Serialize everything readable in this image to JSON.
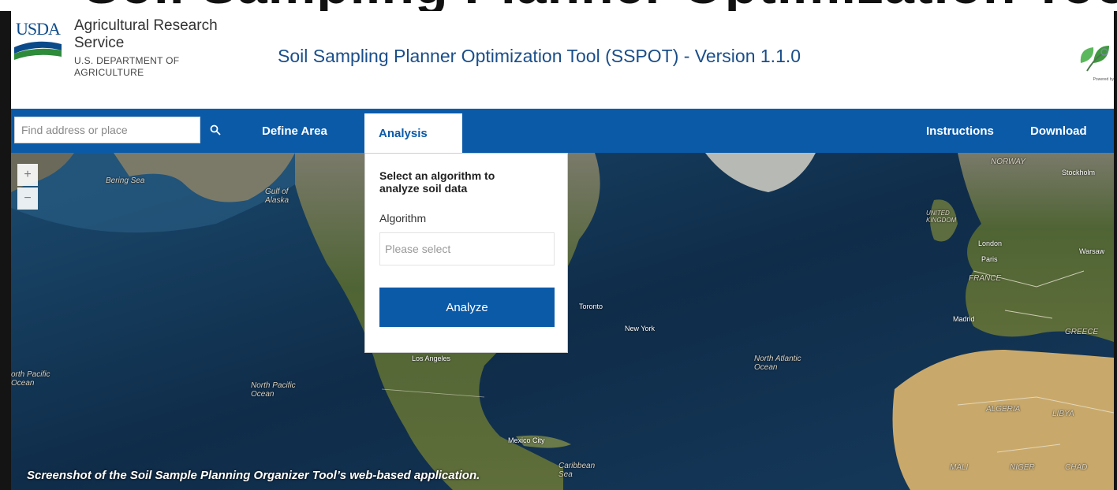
{
  "page_headline": "Soil Sampling Planner Optimization Tool",
  "header": {
    "usda_logo_text": "USDA",
    "agency_line1": "Agricultural Research",
    "agency_line2": "Service",
    "dept_line1": "U.S. DEPARTMENT OF",
    "dept_line2": "AGRICULTURE",
    "app_title": "Soil Sampling Planner Optimization Tool (SSPOT) - Version 1.1.0",
    "powered_by": "Powered by"
  },
  "nav": {
    "search_placeholder": "Find address or place",
    "define_area": "Define Area",
    "analysis": "Analysis",
    "instructions": "Instructions",
    "download": "Download"
  },
  "analysis_panel": {
    "heading": "Select an algorithm to analyze soil data",
    "algorithm_label": "Algorithm",
    "select_placeholder": "Please select",
    "analyze_button": "Analyze"
  },
  "map": {
    "zoom_in": "+",
    "zoom_out": "−",
    "labels": {
      "bering_sea": "Bering Sea",
      "gulf_of_alaska": "Gulf of Alaska",
      "north_pacific_ocean_left": "orth Pacific Ocean",
      "north_pacific_ocean": "North Pacific Ocean",
      "north_atlantic_ocean": "North Atlantic Ocean",
      "toronto": "Toronto",
      "new_york": "New York",
      "los_angeles": "Los Angeles",
      "mexico_city": "Mexico City",
      "caribbean_sea": "Caribbean Sea",
      "norway": "NORWAY",
      "stockholm": "Stockholm",
      "united_kingdom": "UNITED KINGDOM",
      "london": "London",
      "paris": "Paris",
      "france": "FRANCE",
      "warsaw": "Warsaw",
      "madrid": "Madrid",
      "greece": "GREECE",
      "algeria": "ALGERIA",
      "libya": "LIBYA",
      "mali": "MALI",
      "niger": "NIGER",
      "chad": "CHAD"
    }
  },
  "caption": "Screenshot of the Soil Sample Planning Organizer Tool’s web-based application.",
  "colors": {
    "brand_blue": "#0b5aa8",
    "title_blue": "#1a4e8a",
    "ocean": "#10314f",
    "land": "#5b6d3e",
    "desert": "#c9a96b"
  }
}
